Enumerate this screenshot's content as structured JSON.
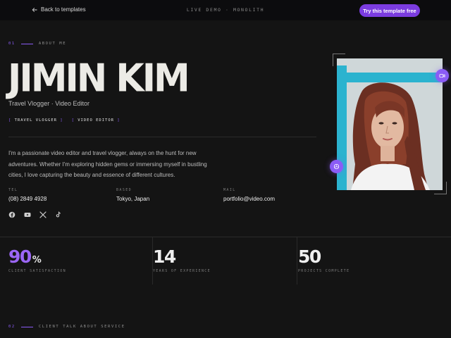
{
  "header": {
    "back_label": "Back to templates",
    "demo_title": "LIVE DEMO · MONOLITH",
    "cta_label": "Try this template free"
  },
  "about": {
    "section_num": "01",
    "section_title": "ABOUT ME",
    "name": "JIMIN KIM",
    "role": "Travel Vlogger · Video Editor",
    "tags": [
      "TRAVEL VLOGGER",
      "VIDEO EDITOR"
    ],
    "bio": "I'm a passionate video editor and travel vlogger, always on the hunt for new adventures. Whether I'm exploring hidden gems or immersing myself in bustling cities, I love capturing the beauty and essence of different cultures.",
    "info": [
      {
        "label": "TEL",
        "value": "(08) 2849 4928"
      },
      {
        "label": "BASED",
        "value": "Tokyo, Japan"
      },
      {
        "label": "MAIL",
        "value": "portfolio@video.com"
      }
    ],
    "socials": [
      "facebook-icon",
      "youtube-icon",
      "x-icon",
      "tiktok-icon"
    ]
  },
  "stats": [
    {
      "number": "90",
      "suffix": "%",
      "label": "CLIENT SATISFACTION"
    },
    {
      "number": "14",
      "suffix": "",
      "label": "YEARS OF EXPERIENCE"
    },
    {
      "number": "50",
      "suffix": "",
      "label": "PROJECTS COMPLETE"
    }
  ],
  "testimonials": {
    "section_num": "02",
    "section_title": "CLIENT TALK ABOUT SERVICE"
  },
  "colors": {
    "accent": "#8b5cf6",
    "background": "#141414",
    "topbar": "#0c0c0e"
  }
}
